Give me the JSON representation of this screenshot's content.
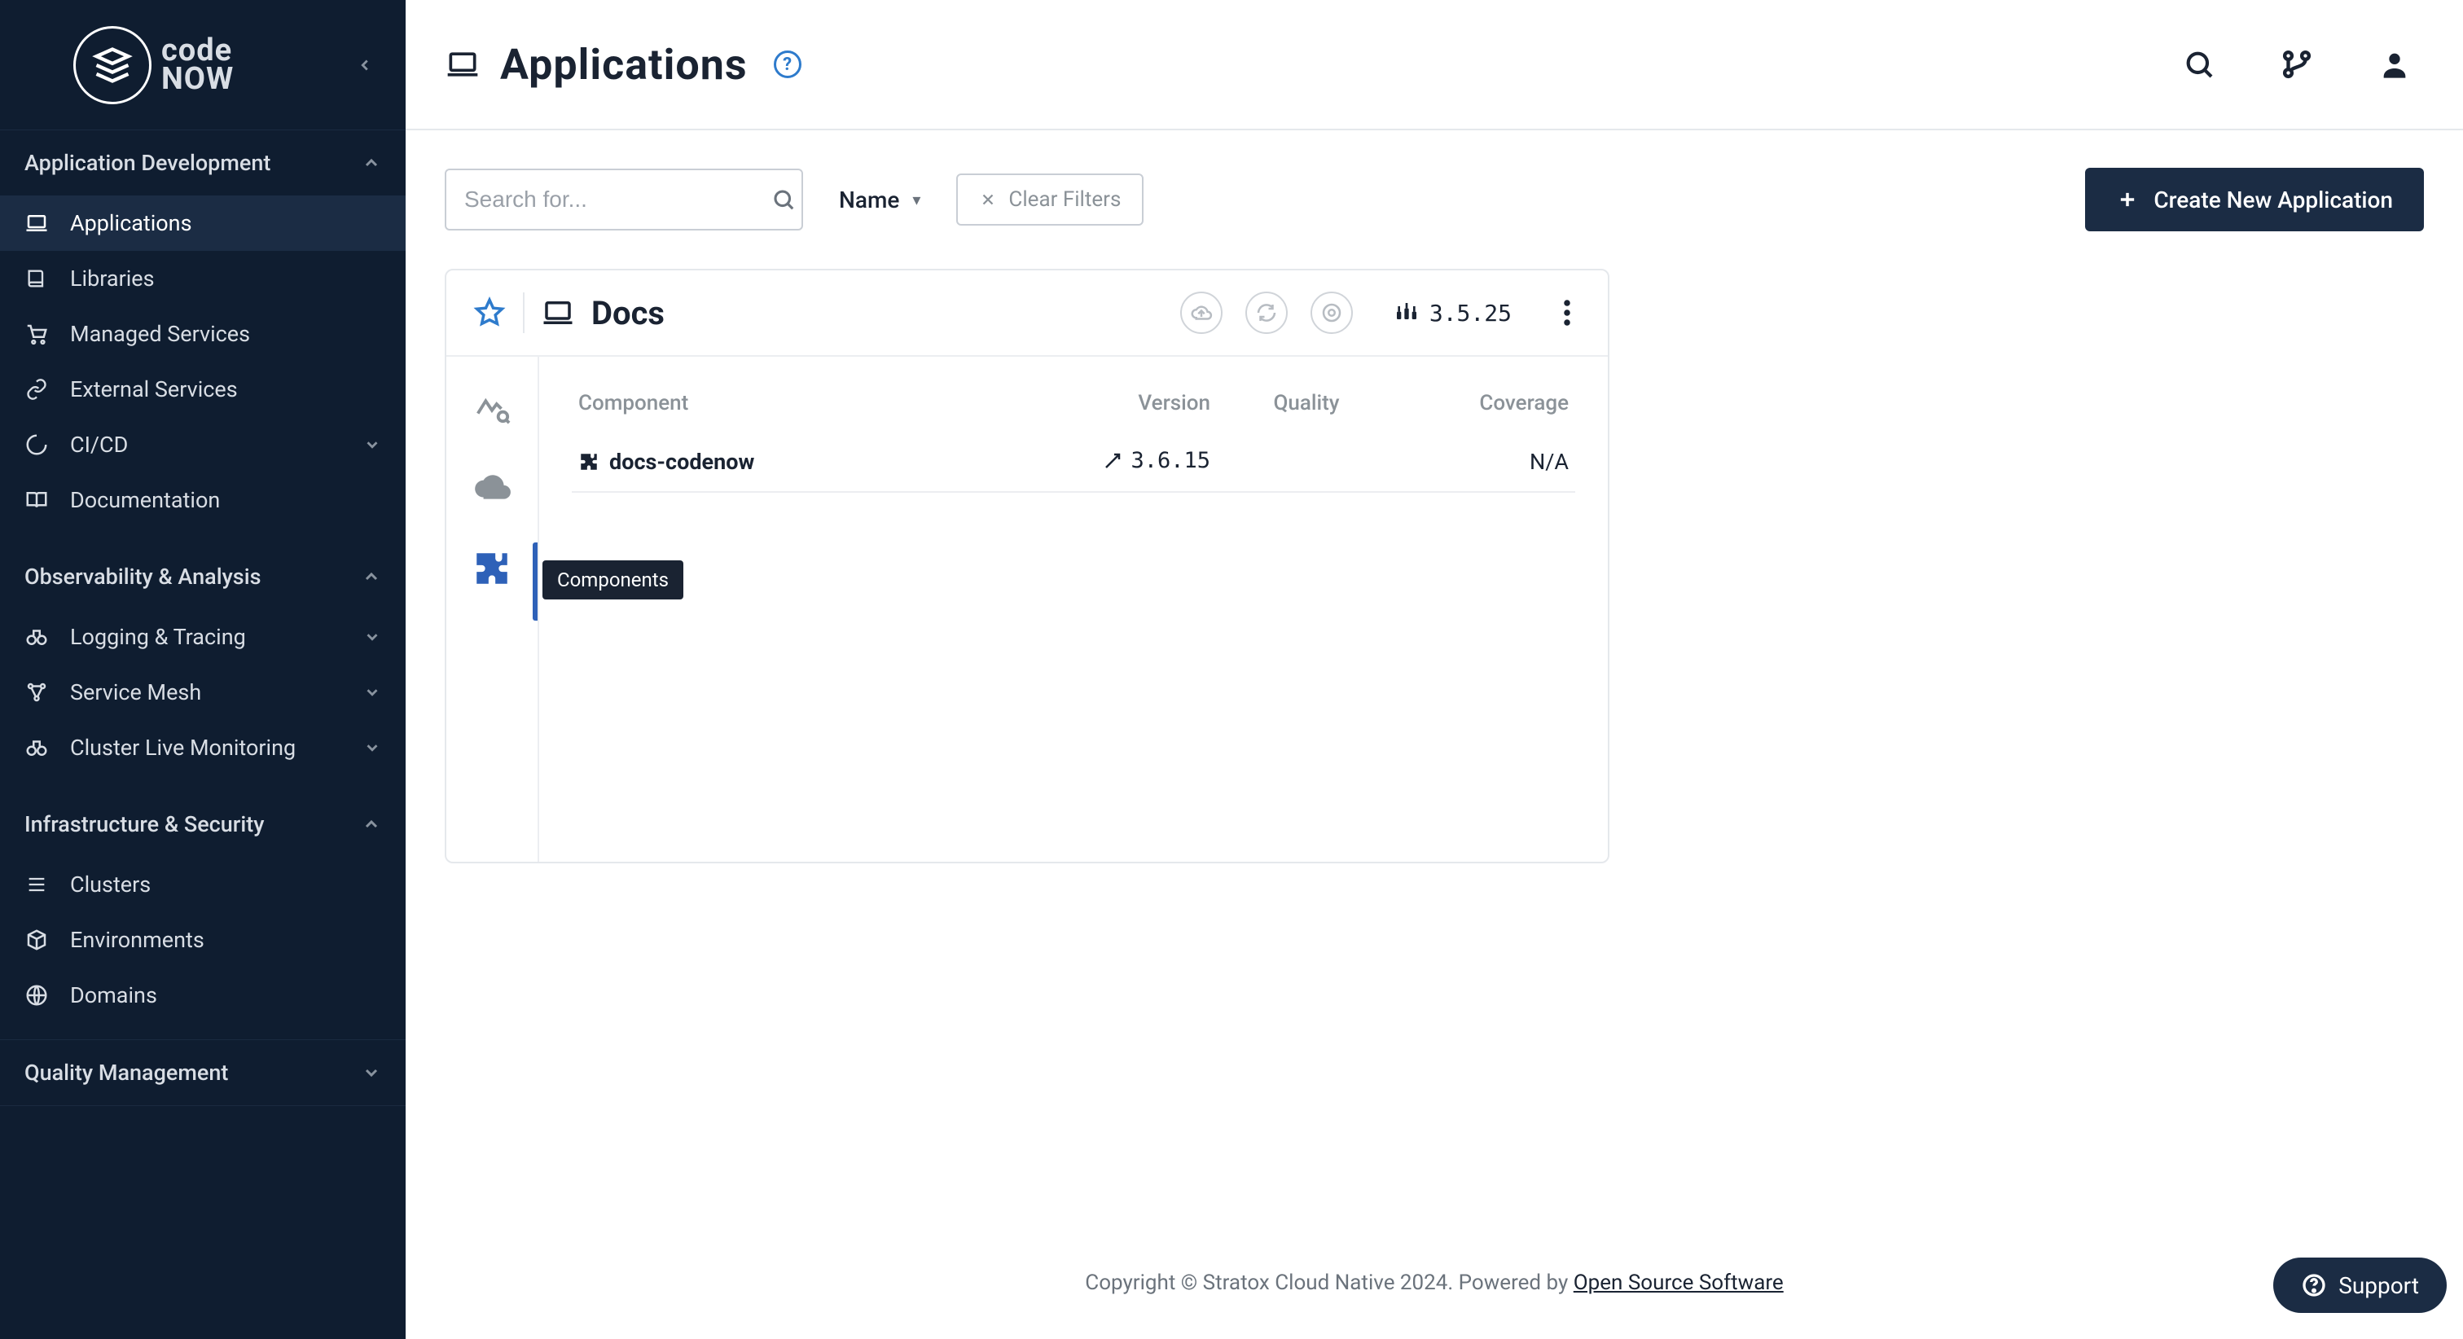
{
  "brand": {
    "line1": "code",
    "line2": "NOW"
  },
  "sidebar": {
    "sections": [
      {
        "label": "Application Development",
        "expanded": true,
        "items": [
          {
            "label": "Applications",
            "active": true,
            "icon": "laptop"
          },
          {
            "label": "Libraries",
            "icon": "book"
          },
          {
            "label": "Managed Services",
            "icon": "cart"
          },
          {
            "label": "External Services",
            "icon": "link"
          },
          {
            "label": "CI/CD",
            "icon": "spinner",
            "chev": true
          },
          {
            "label": "Documentation",
            "icon": "book-open"
          }
        ]
      },
      {
        "label": "Observability & Analysis",
        "expanded": true,
        "items": [
          {
            "label": "Logging & Tracing",
            "icon": "binoculars",
            "chev": true
          },
          {
            "label": "Service Mesh",
            "icon": "graph",
            "chev": true
          },
          {
            "label": "Cluster Live Monitoring",
            "icon": "binoculars",
            "chev": true
          }
        ]
      },
      {
        "label": "Infrastructure & Security",
        "expanded": true,
        "items": [
          {
            "label": "Clusters",
            "icon": "list"
          },
          {
            "label": "Environments",
            "icon": "cube"
          },
          {
            "label": "Domains",
            "icon": "globe"
          }
        ]
      },
      {
        "label": "Quality Management",
        "expanded": false,
        "items": []
      }
    ]
  },
  "page": {
    "title": "Applications",
    "search_placeholder": "Search for...",
    "sort_label": "Name",
    "clear_filters": "Clear Filters",
    "create_button": "Create New Application"
  },
  "card": {
    "title": "Docs",
    "version": "3.5.25",
    "rail_tooltip": "Components",
    "table": {
      "headers": {
        "component": "Component",
        "version": "Version",
        "quality": "Quality",
        "coverage": "Coverage"
      },
      "rows": [
        {
          "name": "docs-codenow",
          "version": "3.6.15",
          "quality": "",
          "coverage": "N/A"
        }
      ]
    }
  },
  "footer": {
    "text_prefix": "Copyright © Stratox Cloud Native 2024. Powered by ",
    "link_text": "Open Source Software"
  },
  "support": {
    "label": "Support"
  }
}
